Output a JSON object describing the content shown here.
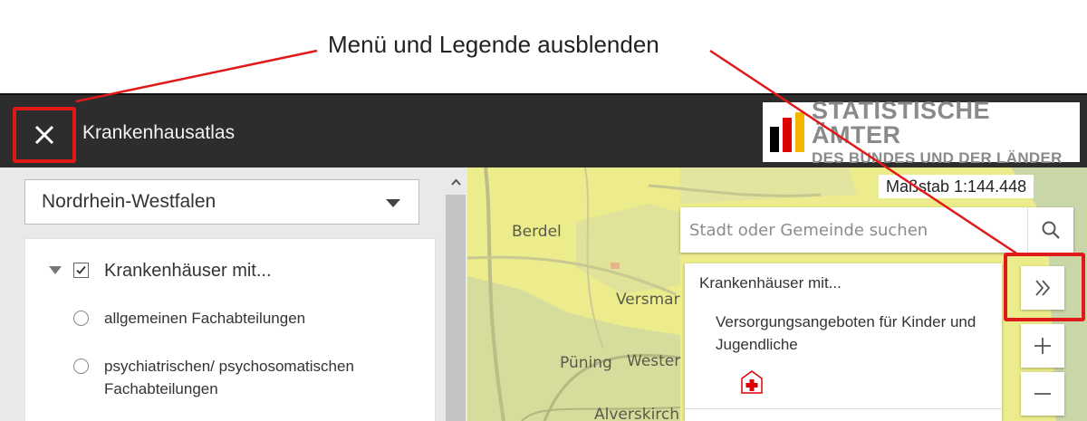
{
  "annotation": {
    "text": "Menü und Legende ausblenden"
  },
  "header": {
    "title": "Krankenhausatlas",
    "logo_line1": "STATISTISCHE ÄMTER",
    "logo_line2": "DES BUNDES UND DER LÄNDER"
  },
  "sidebar": {
    "region": "Nordrhein-Westfalen",
    "layer_title": "Krankenhäuser mit...",
    "options": [
      {
        "label": "allgemeinen Fachabteilungen"
      },
      {
        "label": "psychiatrischen/ psychosomatischen Fachabteilungen"
      }
    ]
  },
  "map": {
    "scale": "Maßstab 1:144.448",
    "search_placeholder": "Stadt oder Gemeinde suchen",
    "places": [
      "Berdel",
      "Versmar",
      "Püning",
      "Wester",
      "Alverskirch"
    ],
    "legend": {
      "title": "Krankenhäuser mit...",
      "item": "Versorgungsangeboten für Kinder und Jugendliche"
    }
  },
  "colors": {
    "header_bg": "#2d2d2d",
    "highlight": "#e01a1a",
    "map_yellow": "#ecec8c",
    "map_green": "#d6dc9c"
  },
  "icons": [
    "close-icon",
    "search-icon",
    "double-chevron-right-icon",
    "plus-icon",
    "minus-icon",
    "hospital-icon",
    "chevron-up-icon"
  ]
}
